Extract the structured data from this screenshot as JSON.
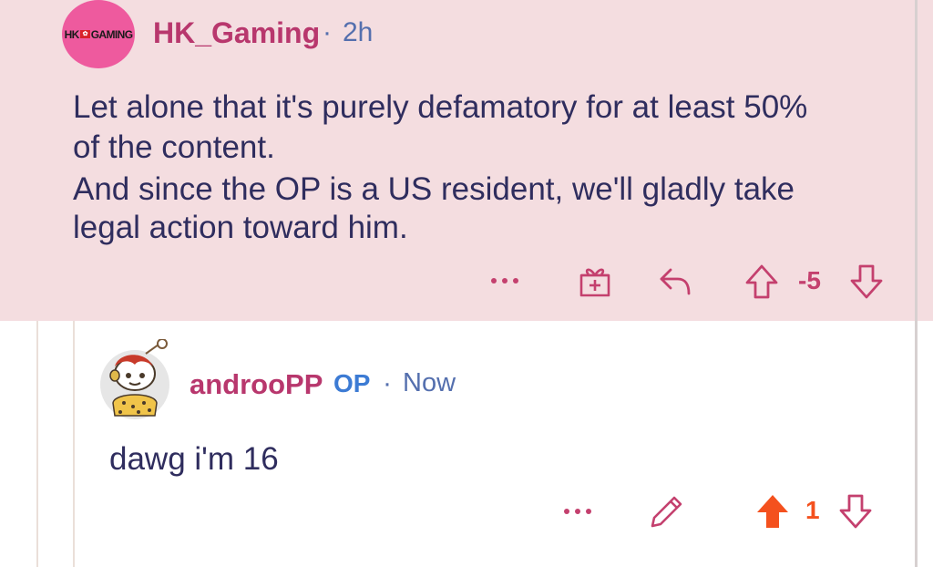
{
  "parent_comment": {
    "avatar_logo_text": "HK GAMING",
    "username": "HK_Gaming",
    "separator": "·",
    "time": "2h",
    "body_lines": [
      "Let alone that it's purely defamatory for at least 50%",
      "of the content.",
      "And since the OP is a US resident, we'll gladly take",
      "legal action toward him."
    ],
    "score": "-5",
    "actions": [
      "more",
      "award",
      "reply",
      "upvote",
      "downvote"
    ]
  },
  "reply_comment": {
    "username": "androoPP",
    "op_tag": "OP",
    "separator": "·",
    "time": "Now",
    "body": "dawg i'm 16",
    "score": "1",
    "upvoted": true,
    "actions": [
      "more",
      "edit",
      "upvote",
      "downvote"
    ]
  },
  "colors": {
    "highlight_bg": "#f4dde0",
    "username": "#b8376d",
    "meta": "#546fae",
    "op_tag": "#3c7bd4",
    "text": "#2f2d5e",
    "action_icon": "#c4406e",
    "upvote_active": "#f4511e",
    "brand_pink": "#ee5a9e"
  }
}
